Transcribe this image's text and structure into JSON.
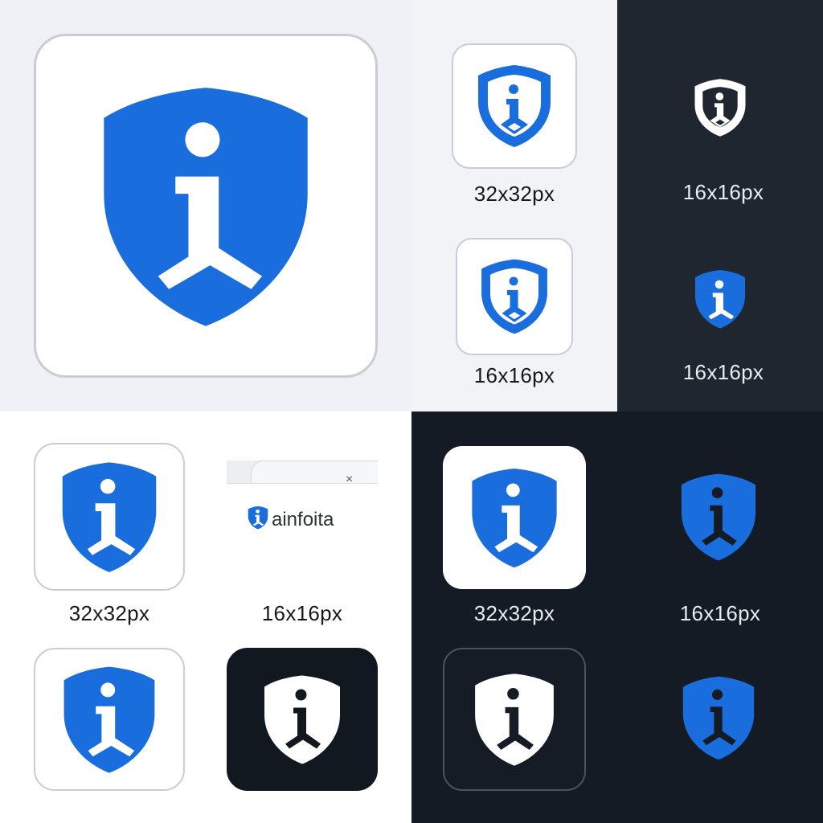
{
  "colors": {
    "brand_blue": "#1a6ddc",
    "white": "#ffffff",
    "dark": "#121820",
    "light_bg": "#eef1f5",
    "dark_panel": "#1f2630"
  },
  "icon": "shield-info-icon",
  "labels": {
    "tm_top": "32x32px",
    "tm_bottom": "16x16px",
    "tr_top": "16x16px",
    "tr_bottom": "16x16px",
    "bl_top_left": "32x32px",
    "bl_top_right": "16x16px",
    "br_top_left": "32x32px",
    "br_top_right": "16x16px"
  },
  "browser_tab": {
    "title": "ainfoita",
    "close_glyph": "×"
  }
}
